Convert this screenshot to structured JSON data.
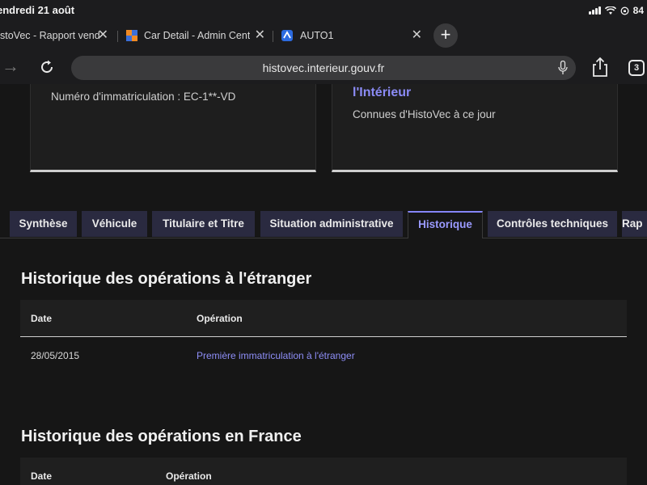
{
  "status": {
    "time": "endredi 21 août",
    "battery": "84"
  },
  "tabs": [
    {
      "title": "stoVec - Rapport vend"
    },
    {
      "title": "Car Detail - Admin Cent"
    },
    {
      "title": "AUTO1"
    }
  ],
  "address": {
    "url": "histovec.interieur.gouv.fr",
    "tab_count": "3"
  },
  "cards": {
    "left_text": "Numéro d'immatriculation : EC-1**-VD",
    "right_title": "l'Intérieur",
    "right_text": "Connues d'HistoVec à ce jour"
  },
  "page_tabs": [
    {
      "label": "Synthèse"
    },
    {
      "label": "Véhicule"
    },
    {
      "label": "Titulaire et Titre"
    },
    {
      "label": "Situation administrative"
    },
    {
      "label": "Historique"
    },
    {
      "label": "Contrôles techniques"
    },
    {
      "label": "Rap"
    }
  ],
  "sections": {
    "foreign": {
      "title": "Historique des opérations à l'étranger",
      "col_date": "Date",
      "col_operation": "Opération",
      "row_date": "28/05/2015",
      "row_operation": "Première immatriculation à l'étranger"
    },
    "france": {
      "title": "Historique des opérations en France",
      "col_date": "Date",
      "col_operation": "Opération"
    }
  },
  "colors": {
    "accent": "#8b8bf5",
    "tab_bg": "#2a2a40",
    "page_bg": "#161616"
  }
}
